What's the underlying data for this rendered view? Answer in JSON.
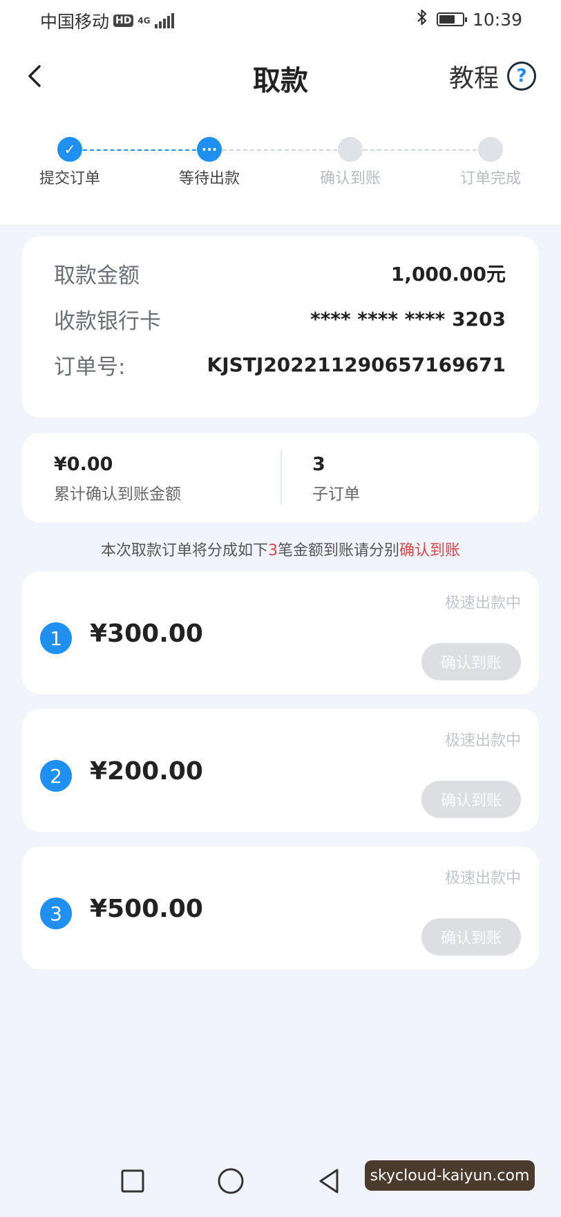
{
  "status_bar": {
    "carrier": "中国移动",
    "hd": "HD",
    "network": "4G",
    "time": "10:39",
    "battery_level": 0.7,
    "icons": [
      "bluetooth-icon",
      "battery-icon",
      "signal-icon"
    ]
  },
  "navbar": {
    "title": "取款",
    "tutorial_label": "教程",
    "help_glyph": "?",
    "back_icon": "chevron-left-icon"
  },
  "steps": [
    {
      "label": "提交订单",
      "state": "done",
      "glyph": "✓"
    },
    {
      "label": "等待出款",
      "state": "current",
      "glyph": "···"
    },
    {
      "label": "确认到账",
      "state": "pending",
      "glyph": ""
    },
    {
      "label": "订单完成",
      "state": "pending",
      "glyph": ""
    }
  ],
  "withdrawal": {
    "amount_label": "取款金额",
    "amount_value": "1,000.00元",
    "bank_label": "收款银行卡",
    "bank_value": "**** **** **** 3203",
    "order_label": "订单号:",
    "order_value": "KJSTJ20221129065716967​1"
  },
  "summary": {
    "confirmed_value": "¥0.00",
    "confirmed_label": "累计确认到账金额",
    "suborder_value": "3",
    "suborder_label": "子订单"
  },
  "notice": {
    "prefix": "本次取款订单将分成如下",
    "count": "3",
    "middle": "笔金额到账请分别",
    "action": "确认到账"
  },
  "orders": [
    {
      "index": "1",
      "amount": "¥300.00",
      "status": "极速出款中",
      "button": "确认到账"
    },
    {
      "index": "2",
      "amount": "¥200.00",
      "status": "极速出款中",
      "button": "确认到账"
    },
    {
      "index": "3",
      "amount": "¥500.00",
      "status": "极速出款中",
      "button": "确认到账"
    }
  ],
  "watermark": "skycloud-kaiyun.com",
  "colors": {
    "accent": "#1f8ff2",
    "highlight": "#e0424a",
    "background": "#f1f4fb",
    "disabled_button": "#dcdee1"
  }
}
